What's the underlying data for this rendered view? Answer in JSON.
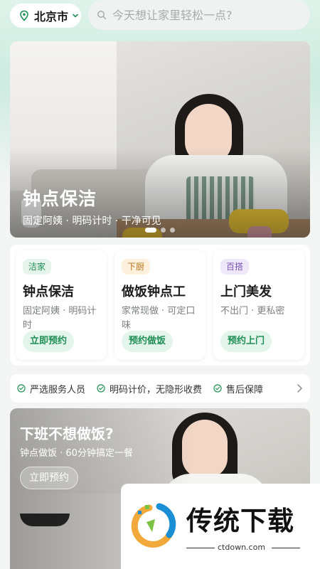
{
  "header": {
    "city": "北京市",
    "search_placeholder": "今天想让家里轻松一点?"
  },
  "banner": {
    "title": "钟点保洁",
    "subtitle": "固定阿姨 · 明码计时 · 干净可见",
    "slide_count": 3,
    "active_slide": 1
  },
  "services": [
    {
      "tag": "洁家",
      "title": "钟点保洁",
      "desc": "固定阿姨 · 明码计时",
      "button": "立即预约",
      "tag_bg": "#e6f5ec",
      "tag_color": "#1f8f55"
    },
    {
      "tag": "下厨",
      "title": "做饭钟点工",
      "desc": "家常现做 · 可定口味",
      "button": "预约做饭",
      "tag_bg": "#fdf0dd",
      "tag_color": "#b7731a"
    },
    {
      "tag": "百搭",
      "title": "上门美发",
      "desc": "不出门 · 更私密",
      "button": "预约上门",
      "tag_bg": "#efe8f8",
      "tag_color": "#7a55b0"
    }
  ],
  "guarantees": [
    "严选服务人员",
    "明码计价，无隐形收费",
    "售后保障"
  ],
  "promo": {
    "title": "下班不想做饭?",
    "subtitle": "钟点做饭 · 60分钟搞定一餐",
    "button": "立即预约"
  },
  "watermark": {
    "text": "传统下载",
    "url": "ctdown.com"
  },
  "colors": {
    "accent": "#1f8f55",
    "accent_light": "#e4f5ec",
    "page_bg": "#f3f5f4"
  },
  "icons": {
    "location": "location-pin-icon",
    "dropdown": "chevron-down-icon",
    "search": "search-icon",
    "check": "check-circle-icon",
    "more": "chevron-right-icon"
  }
}
